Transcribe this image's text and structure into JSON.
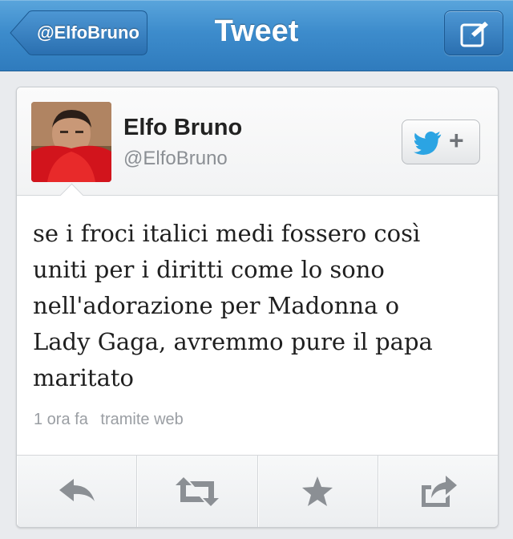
{
  "navbar": {
    "title": "Tweet",
    "back_label": "@ElfoBruno",
    "compose_icon": "compose-icon",
    "color": "#3d8ccc"
  },
  "tweet": {
    "author_name": "Elfo Bruno",
    "author_handle": "@ElfoBruno",
    "text": "se i froci italici medi fossero così\nuniti per i diritti come lo sono\nnell'adorazione per Madonna o\nLady Gaga, avremmo pure il papa\nmaritato",
    "time": "1 ora fa",
    "source": "tramite web"
  },
  "follow_button": {
    "icon": "twitter-bird-icon",
    "plus": "+"
  },
  "actions": [
    {
      "name": "reply",
      "icon": "reply-icon"
    },
    {
      "name": "retweet",
      "icon": "retweet-icon"
    },
    {
      "name": "favorite",
      "icon": "star-icon"
    },
    {
      "name": "share",
      "icon": "share-icon"
    }
  ]
}
